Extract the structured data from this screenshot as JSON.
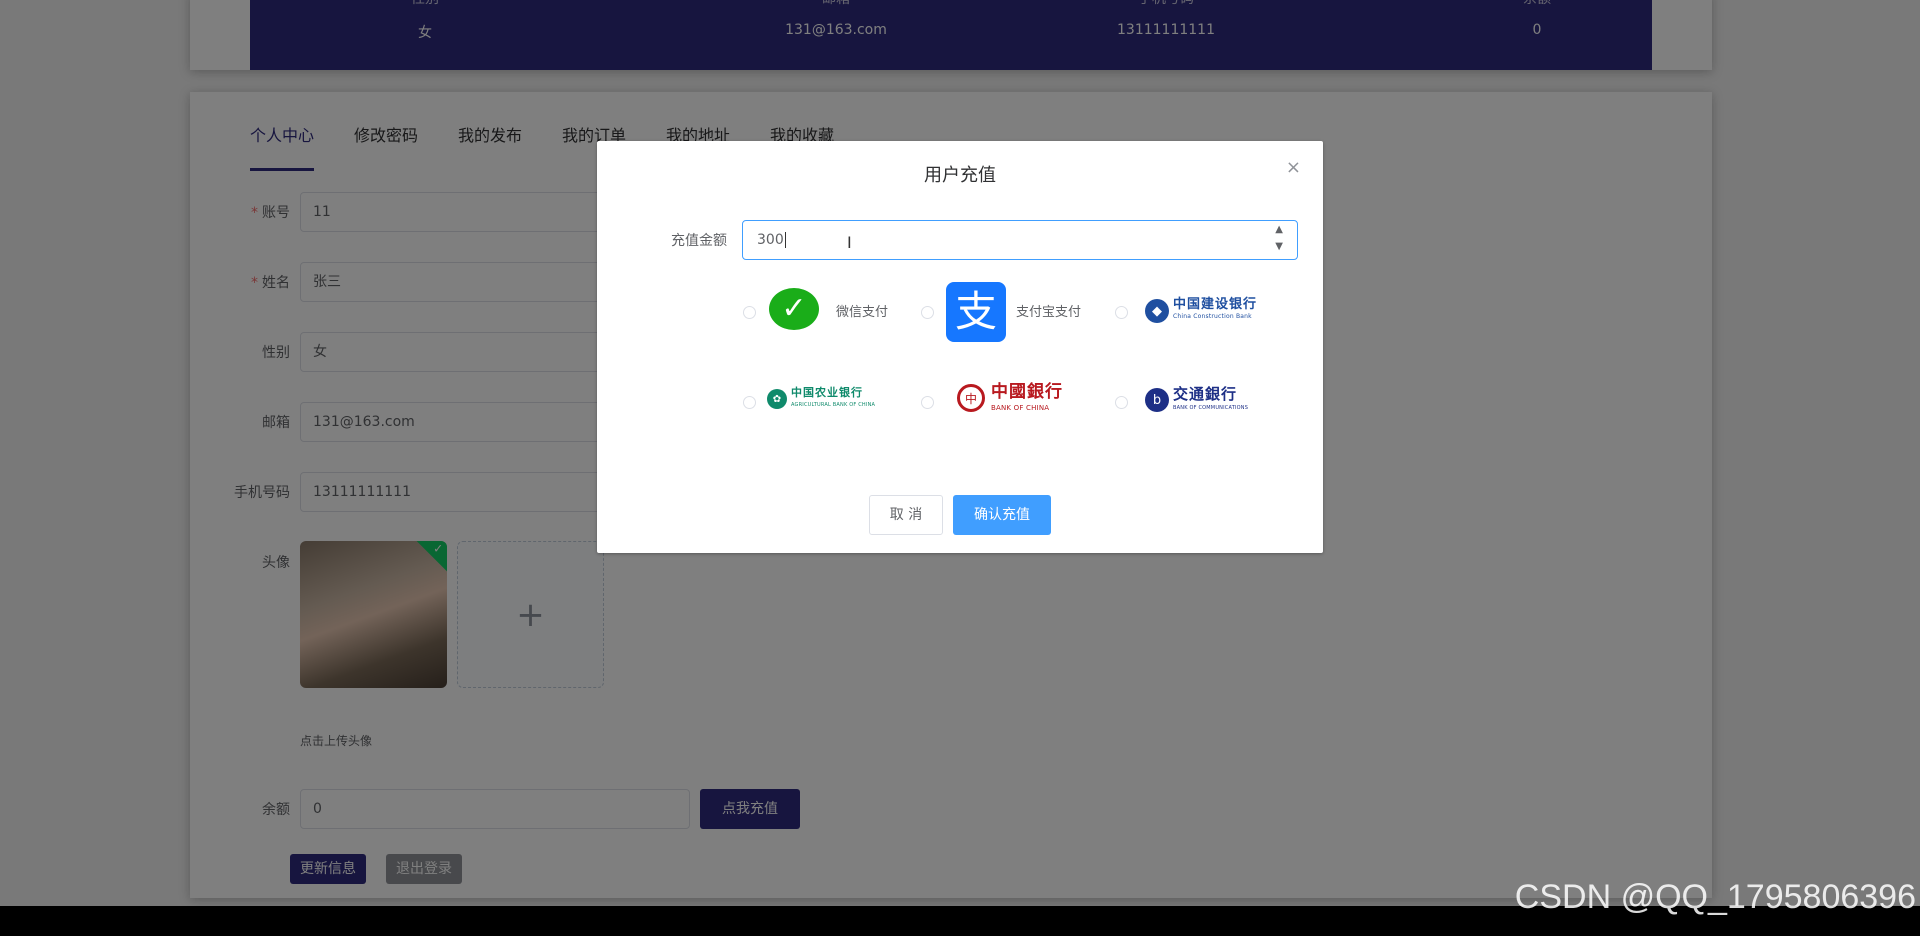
{
  "info_table": {
    "headers": [
      "性别",
      "邮箱",
      "手机号码",
      "余额"
    ],
    "row": [
      "女",
      "131@163.com",
      "13111111111",
      "0"
    ]
  },
  "tabs": [
    "个人中心",
    "修改密码",
    "我的发布",
    "我的订单",
    "我的地址",
    "我的收藏"
  ],
  "form": {
    "account_label": "账号",
    "account_value": "11",
    "name_label": "姓名",
    "name_value": "张三",
    "gender_label": "性别",
    "gender_value": "女",
    "email_label": "邮箱",
    "email_value": "131@163.com",
    "phone_label": "手机号码",
    "phone_value": "13111111111",
    "avatar_label": "头像",
    "avatar_upload_icon": "+",
    "avatar_hint": "点击上传头像",
    "balance_label": "余额",
    "balance_value": "0",
    "recharge_button": "点我充值",
    "update_button": "更新信息",
    "logout_button": "退出登录",
    "required_mark": "*"
  },
  "dialog": {
    "title": "用户充值",
    "close_icon": "×",
    "amount_label": "充值金额",
    "amount_value": "300",
    "spin_up": "▲",
    "spin_down": "▼",
    "cursor": "I",
    "payment_options": [
      "微信支付",
      "支付宝支付",
      "中国建设银行",
      "中国农业银行",
      "中国银行",
      "交通银行"
    ],
    "bank_logos": {
      "ccb": {
        "cn": "中国建设银行",
        "en": "China Construction Bank"
      },
      "abc": {
        "cn": "中国农业银行",
        "en": "AGRICULTURAL BANK OF CHINA"
      },
      "boc": {
        "cn": "中國銀行",
        "en": "BANK OF CHINA"
      },
      "bocom": {
        "cn": "交通銀行",
        "en": "BANK OF COMMUNICATIONS"
      }
    },
    "alipay_glyph": "支",
    "cancel_button": "取 消",
    "confirm_button": "确认充值"
  },
  "watermark": "CSDN @QQ_1795806396",
  "colors": {
    "accent": "#2f2a7e",
    "primary": "#409eff",
    "wechat": "#1aad19",
    "alipay": "#1677ff",
    "ccb": "#1f4fa0",
    "abc": "#0f8a6b",
    "boc": "#b8191f",
    "bocom": "#1d2f86"
  }
}
